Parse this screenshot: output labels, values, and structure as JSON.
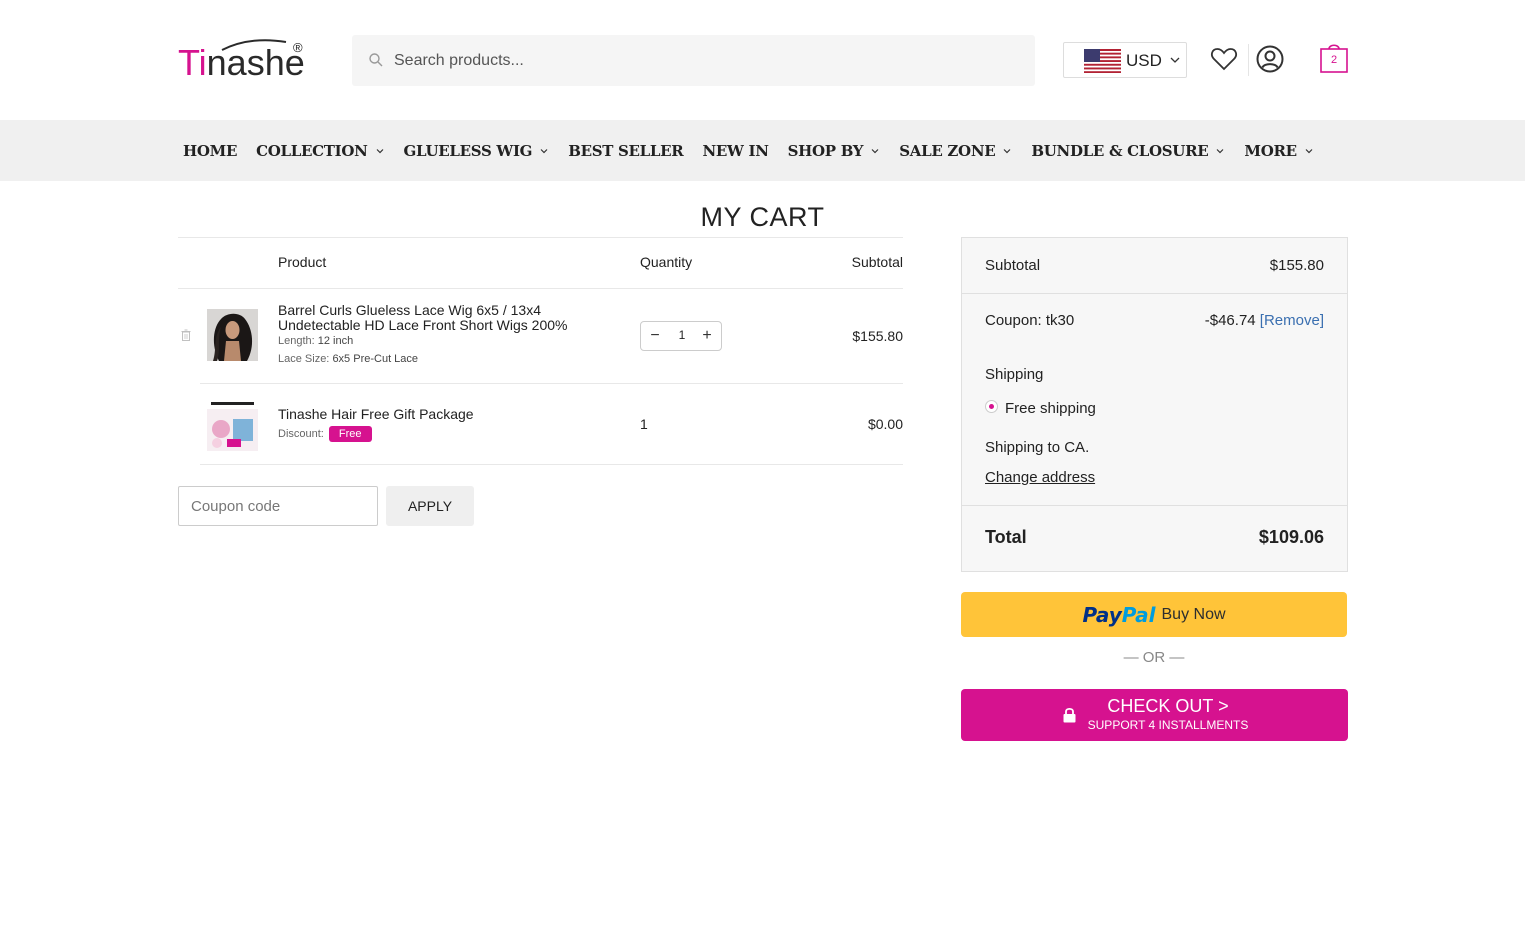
{
  "brand": {
    "logo_accent": "Ti",
    "logo_rest": "nashe",
    "logo_reg": "®",
    "accent_color": "#d6128f"
  },
  "search": {
    "placeholder": "Search products..."
  },
  "currency": {
    "label": "USD"
  },
  "header_icons": [
    "heart-icon",
    "account-icon",
    "cart-icon"
  ],
  "cart_count": "2",
  "nav": [
    {
      "label": "HOME",
      "dropdown": false
    },
    {
      "label": "COLLECTION",
      "dropdown": true
    },
    {
      "label": "GLUELESS WIG",
      "dropdown": true
    },
    {
      "label": "BEST SELLER",
      "dropdown": false
    },
    {
      "label": "NEW IN",
      "dropdown": false
    },
    {
      "label": "SHOP BY",
      "dropdown": true
    },
    {
      "label": "SALE ZONE",
      "dropdown": true
    },
    {
      "label": "BUNDLE & CLOSURE",
      "dropdown": true
    },
    {
      "label": "MORE",
      "dropdown": true
    }
  ],
  "page_title": "MY CART",
  "cart_table": {
    "headers": {
      "product": "Product",
      "quantity": "Quantity",
      "subtotal": "Subtotal"
    },
    "items": [
      {
        "name_line1": "Barrel Curls Glueless Lace Wig 6x5 / 13x4",
        "name_line2": "Undetectable HD Lace Front Short Wigs 200%",
        "meta1_label": "Length:",
        "meta1_value": "12 inch",
        "meta2_label": "Lace Size:",
        "meta2_value": "6x5 Pre-Cut Lace",
        "quantity": "1",
        "minus": "−",
        "plus": "+",
        "subtotal": "$155.80"
      },
      {
        "name_line1": "Tinashe Hair Free Gift Package",
        "meta1_label": "Discount:",
        "badge": "Free",
        "quantity": "1",
        "subtotal": "$0.00"
      }
    ]
  },
  "coupon": {
    "placeholder": "Coupon code",
    "apply_label": "APPLY"
  },
  "totals": {
    "subtotal_label": "Subtotal",
    "subtotal_value": "$155.80",
    "coupon_label": "Coupon: tk30",
    "coupon_value": "-$46.74",
    "coupon_remove": "[Remove]",
    "shipping_label": "Shipping",
    "shipping_option": "Free shipping",
    "shipping_to": "Shipping to CA.",
    "change_address": "Change address",
    "total_label": "Total",
    "total_value": "$109.06"
  },
  "paypal": {
    "pay": "Pay",
    "pal": "Pal",
    "buy_now": "Buy Now"
  },
  "or_text": "— OR —",
  "checkout": {
    "main": "CHECK OUT >",
    "sub": "SUPPORT 4 INSTALLMENTS"
  }
}
